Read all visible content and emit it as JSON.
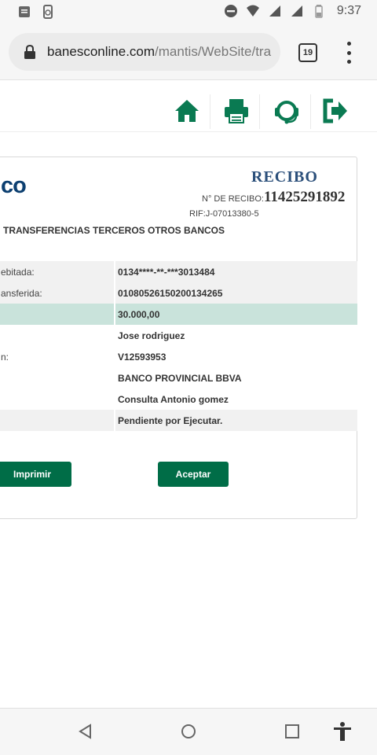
{
  "status_bar": {
    "time": "9:37",
    "left_icons": [
      "notification-icon",
      "sync-icon"
    ],
    "right_icons": [
      "do-not-disturb-icon",
      "wifi-icon",
      "signal-icon",
      "signal-icon",
      "battery-icon"
    ]
  },
  "browser": {
    "url_domain": "banesconline.com",
    "url_path": "/mantis/WebSite/tra",
    "tab_count": "19"
  },
  "toolbar": {
    "icons": [
      "home-icon",
      "print-icon",
      "support-icon",
      "logout-icon"
    ],
    "icon_color": "#0a7a52"
  },
  "receipt": {
    "logo_fragment": "co",
    "title": "RECIBO",
    "number_label": "N° DE RECIBO:",
    "number": "11425291892",
    "rif": "RIF:J-07013380-5",
    "transaction_type": "TRANSFERENCIAS TERCEROS OTROS BANCOS",
    "rows": [
      {
        "label": "ebitada:",
        "value": "0134****-**-***3013484"
      },
      {
        "label": "ansferida:",
        "value": "01080526150200134265"
      },
      {
        "label": "",
        "value": "30.000,00"
      },
      {
        "label": "",
        "value": "Jose rodriguez"
      },
      {
        "label": "n:",
        "value": "V12593953"
      },
      {
        "label": "",
        "value": "BANCO PROVINCIAL BBVA"
      },
      {
        "label": "",
        "value": "Consulta Antonio gomez"
      },
      {
        "label": "",
        "value": "Pendiente por Ejecutar."
      }
    ],
    "print_button": "Imprimir",
    "accept_button": "Aceptar"
  },
  "colors": {
    "brand_green": "#006d47",
    "highlight_row": "#c9e3db",
    "title_blue": "#2b4f7a"
  },
  "nav_bar": {
    "icons": [
      "back-icon",
      "home-icon",
      "recents-icon",
      "accessibility-icon"
    ]
  }
}
